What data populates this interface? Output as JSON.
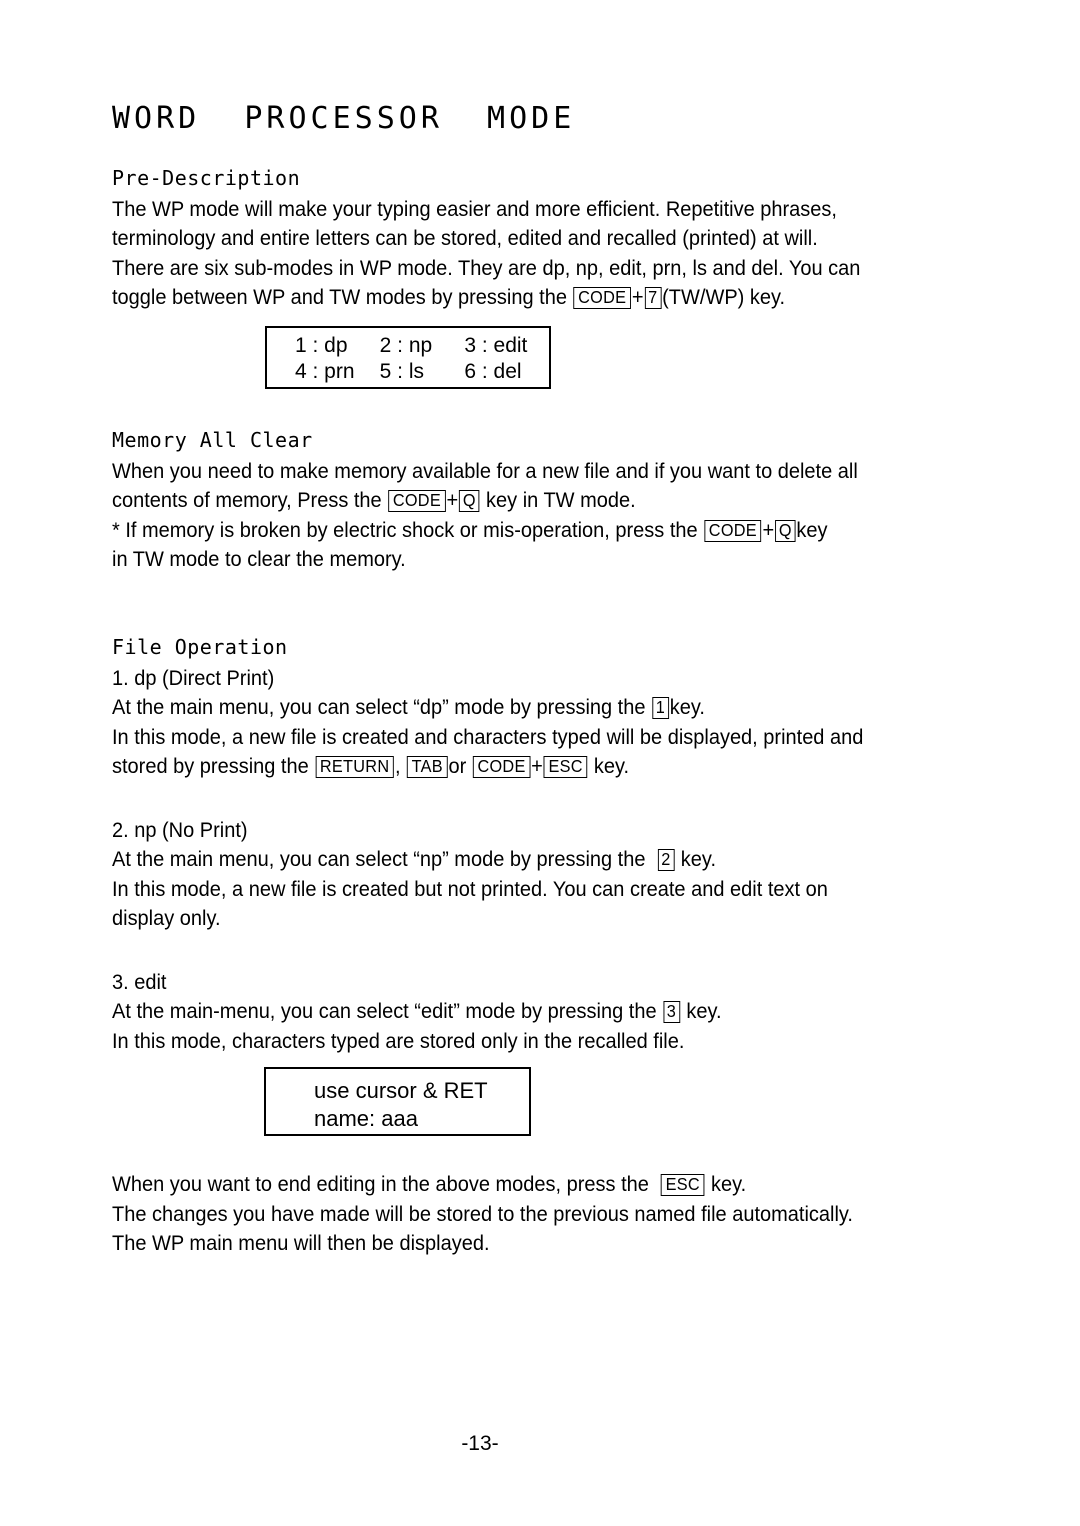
{
  "document": {
    "title": "WORD  PROCESSOR  MODE",
    "page_number": "-13-"
  },
  "sections": {
    "pre_description": {
      "heading": "Pre-Description",
      "lines": [
        "The WP mode will make your typing easier and more efficient. Repetitive phrases,",
        "terminology and entire letters can be stored, edited and recalled (printed) at will.",
        "There are six sub-modes in WP mode. They are dp, np, edit, prn, ls and del. You can"
      ],
      "toggle_line": {
        "before": "toggle between WP and TW modes by pressing the",
        "key1": "CODE",
        "plus": "+",
        "key2": "7",
        "after": "(TW/WP) key."
      }
    },
    "memory_all_clear": {
      "heading": "Memory All Clear",
      "line1": "When you need to make memory available for a new file and if you want to delete all",
      "line2": {
        "before": "contents of memory, Press the",
        "key1": "CODE",
        "plus": "+",
        "key2": "Q",
        "after": "key in TW mode."
      },
      "line3": {
        "before": "*  If memory is broken by electric shock or mis-operation, press the",
        "key1": "CODE",
        "plus": "+",
        "key2": "Q",
        "after": "key"
      },
      "line4": "in TW mode to clear the memory."
    },
    "file_operation": {
      "heading": "File Operation",
      "items": [
        {
          "title": "1. dp (Direct Print)",
          "line1": {
            "before": "At the main menu, you can select “dp” mode by pressing the",
            "key": "1",
            "after": "key."
          },
          "line2": "In this mode, a new file is created and characters typed will be displayed, printed and",
          "line3": {
            "before": "stored by pressing the",
            "key1": "RETURN",
            "comma": ",",
            "key2": "TAB",
            "or": "or",
            "key3": "CODE",
            "plus": "+",
            "key4": "ESC",
            "after": "key."
          }
        },
        {
          "title": "2. np (No Print)",
          "line1": {
            "before": "At the main menu, you can select “np” mode by pressing the",
            "key": "2",
            "after": "key."
          },
          "line2": "In this mode, a new file is created but not printed. You can create and edit text on",
          "line3": "display only."
        },
        {
          "title": "3. edit",
          "line1": {
            "before": "At the main-menu, you can select “edit” mode by pressing the",
            "key": "3",
            "after": "key."
          },
          "line2": "In this mode, characters typed are stored only in the recalled file."
        }
      ]
    },
    "closing": {
      "line1": {
        "before": "When you want to end editing in the above modes, press the",
        "key": "ESC",
        "after": "key."
      },
      "line2": "The changes you have made will be stored to the previous named file automatically.",
      "line3": "The WP main menu will then be displayed."
    }
  },
  "lcd_menu_box": {
    "row1": [
      "1 : dp",
      "2 : np",
      "3 : edit"
    ],
    "row2": [
      "4 : prn",
      "5 : ls",
      "6 : del"
    ]
  },
  "lcd_name_box": {
    "row1": "use cursor & RET",
    "row2": "name: aaa"
  }
}
